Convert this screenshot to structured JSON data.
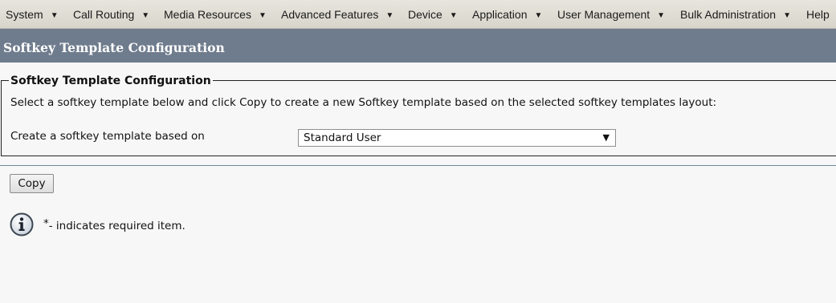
{
  "menu": {
    "items": [
      {
        "label": "System"
      },
      {
        "label": "Call Routing"
      },
      {
        "label": "Media Resources"
      },
      {
        "label": "Advanced Features"
      },
      {
        "label": "Device"
      },
      {
        "label": "Application"
      },
      {
        "label": "User Management"
      },
      {
        "label": "Bulk Administration"
      },
      {
        "label": "Help"
      }
    ]
  },
  "page": {
    "title": "Softkey Template Configuration"
  },
  "section": {
    "legend": "Softkey Template Configuration",
    "description": "Select a softkey template below and click Copy to create a new Softkey template based on the selected softkey templates layout:",
    "field_label": "Create a softkey template based on",
    "select_value": "Standard User"
  },
  "actions": {
    "copy_label": "Copy"
  },
  "footer": {
    "required_star": "*",
    "required_text": "- indicates required item."
  },
  "icons": {
    "dropdown": "caret-down-icon",
    "info": "info-icon"
  },
  "colors": {
    "menubar": "#dedbd2",
    "titleband": "#6f7c8d",
    "background": "#f7f7f7"
  }
}
